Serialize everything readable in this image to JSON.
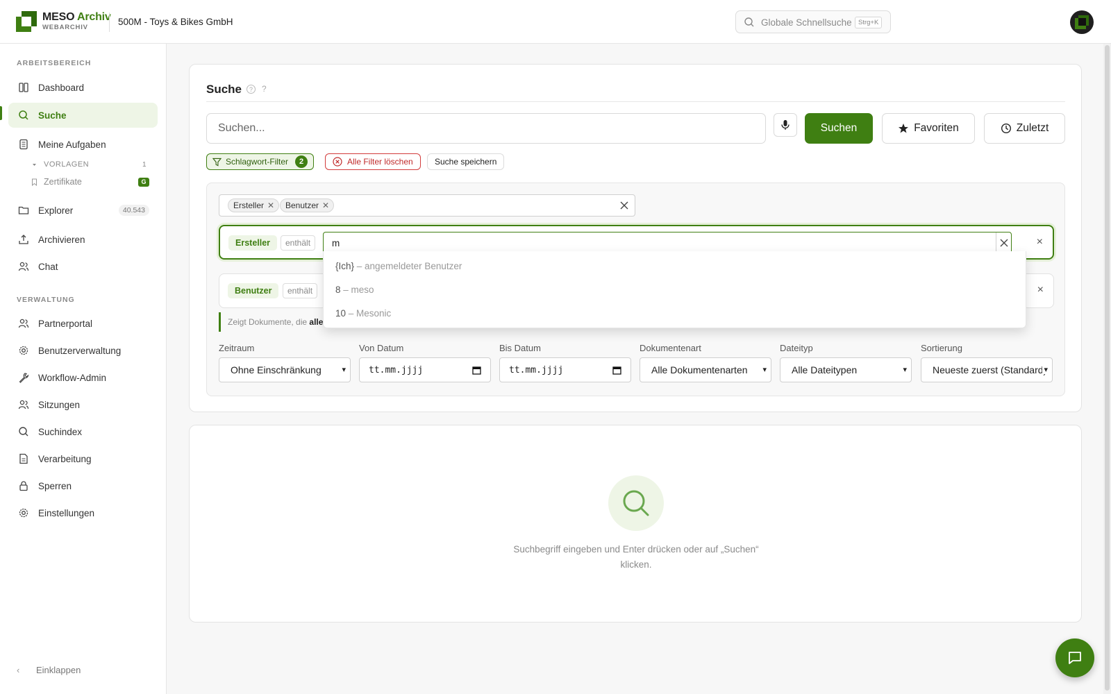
{
  "header": {
    "brand_name": "MESO",
    "brand_accent": "Archiv",
    "brand_sub": "WEBARCHIV",
    "company": "500M - Toys & Bikes GmbH",
    "global_search_placeholder": "Globale Schnellsuche",
    "global_search_shortcut": "Strg+K"
  },
  "sidebar": {
    "section_work": "ARBEITSBEREICH",
    "section_admin": "VERWALTUNG",
    "items": [
      {
        "label": "Dashboard"
      },
      {
        "label": "Suche"
      },
      {
        "label": "Meine Aufgaben"
      },
      {
        "label": "Explorer",
        "count": "40.543"
      },
      {
        "label": "Archivieren"
      },
      {
        "label": "Chat"
      },
      {
        "label": "Partnerportal"
      },
      {
        "label": "Benutzerverwaltung"
      },
      {
        "label": "Workflow-Admin"
      },
      {
        "label": "Sitzungen"
      },
      {
        "label": "Suchindex"
      },
      {
        "label": "Verarbeitung"
      },
      {
        "label": "Sperren"
      },
      {
        "label": "Einstellungen"
      }
    ],
    "sub_vorlagen": {
      "label": "VORLAGEN",
      "count": "1"
    },
    "sub_zertifikate": {
      "label": "Zertifikate",
      "badge": "G"
    },
    "collapse": "Einklappen"
  },
  "search": {
    "title": "Suche",
    "help": "?",
    "placeholder": "Suchen...",
    "search_button": "Suchen",
    "favorites_button": "Favoriten",
    "recent_button": "Zuletzt",
    "filter_chip": "Schlagwort-Filter",
    "filter_count": "2",
    "clear_filters": "Alle Filter löschen",
    "save_search": "Suche speichern"
  },
  "filters": {
    "tags": [
      "Ersteller",
      "Benutzer"
    ],
    "rows": [
      {
        "name": "Ersteller",
        "op": "enthält",
        "value": "m"
      },
      {
        "name": "Benutzer",
        "op": "enthält"
      }
    ],
    "hint_prefix": "Zeigt Dokumente, die",
    "hint_bold": "alle"
  },
  "dropdown": {
    "options": [
      {
        "key": "{Ich}",
        "rest": " – angemeldeter Benutzer"
      },
      {
        "key": "8",
        "rest": " – meso"
      },
      {
        "key": "10",
        "rest": " – Mesonic"
      }
    ]
  },
  "fields": {
    "zeitraum": {
      "label": "Zeitraum",
      "value": "Ohne Einschränkung"
    },
    "von": {
      "label": "Von Datum",
      "value": "tt.mm.jjjj"
    },
    "bis": {
      "label": "Bis Datum",
      "value": "tt.mm.jjjj"
    },
    "doktyp": {
      "label": "Dokumentenart",
      "value": "Alle Dokumentenarten"
    },
    "dateityp": {
      "label": "Dateityp",
      "value": "Alle Dateitypen"
    },
    "sortierung": {
      "label": "Sortierung",
      "value": "Neueste zuerst (Standard)"
    }
  },
  "empty": {
    "text": "Suchbegriff eingeben und Enter drücken oder auf „Suchen“ klicken."
  },
  "colors": {
    "accent": "#3f7f12",
    "accent_light": "#eef5e6",
    "danger": "#c02a2a"
  }
}
